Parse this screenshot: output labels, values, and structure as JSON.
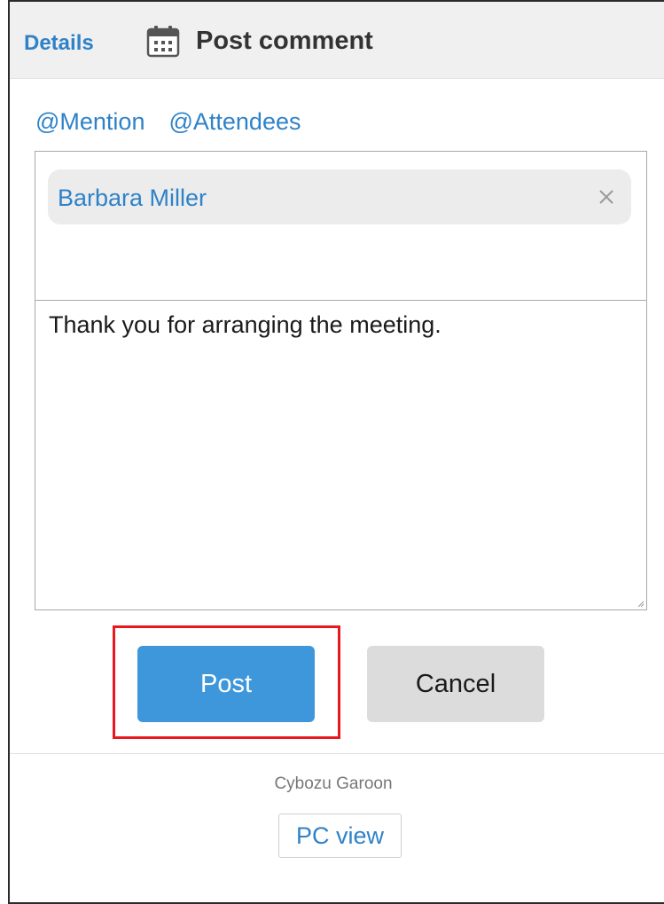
{
  "header": {
    "details_link": "Details",
    "title": "Post comment",
    "icon": "calendar-icon"
  },
  "mentions": {
    "mention_link": "@Mention",
    "attendees_link": "@Attendees"
  },
  "recipients": [
    {
      "name": "Barbara Miller",
      "remove_icon": "close-icon"
    }
  ],
  "comment": {
    "value": "Thank you for arranging the meeting."
  },
  "actions": {
    "post_label": "Post",
    "cancel_label": "Cancel"
  },
  "footer": {
    "brand": "Cybozu Garoon",
    "pc_view_label": "PC view"
  },
  "colors": {
    "link": "#2f82c8",
    "primary_button": "#3e97db",
    "secondary_button": "#dcdcdc",
    "highlight": "#e8191e"
  }
}
